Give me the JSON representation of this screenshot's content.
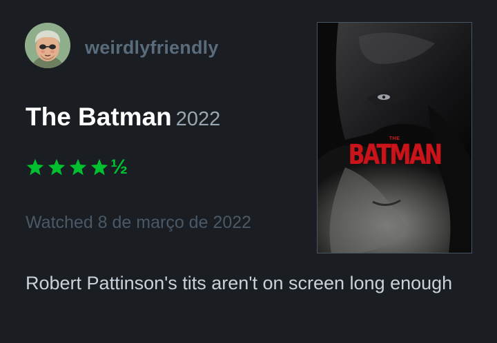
{
  "review": {
    "username": "weirdlyfriendly",
    "film_title": "The Batman",
    "film_year": "2022",
    "rating": {
      "stars": 4.5,
      "max": 5,
      "half_glyph": "½"
    },
    "watched_text": "Watched 8 de março de 2022",
    "body": "Robert Pattinson's tits aren't on screen long enough"
  },
  "poster": {
    "small_text": "THE",
    "title_text": "BATMAN"
  },
  "colors": {
    "background": "#1a1d22",
    "star": "#00c030",
    "username": "#5a6b7c",
    "poster_red": "#c8141a"
  },
  "icons": {
    "avatar": "avatar-face",
    "star": "star-icon"
  }
}
